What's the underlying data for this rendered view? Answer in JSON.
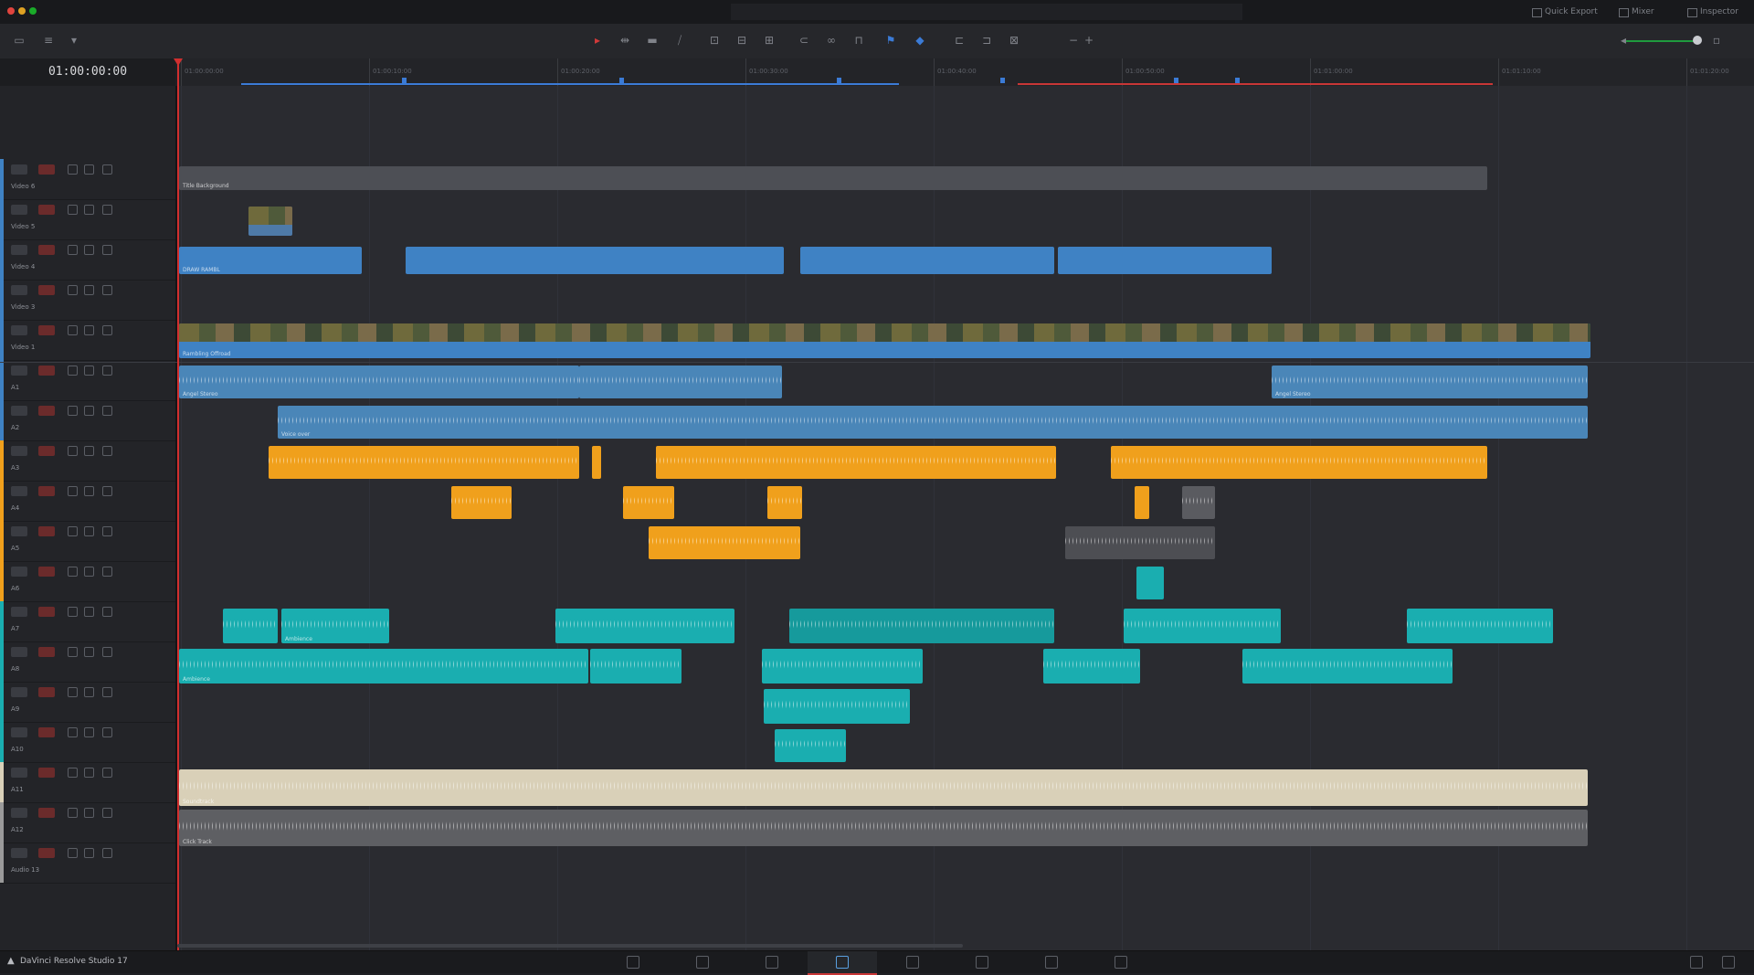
{
  "titlebar": {
    "buttons": [
      "Quick Export",
      "Mixer",
      "Inspector"
    ]
  },
  "timecode": "01:00:00:00",
  "ruler": {
    "labels": [
      "01:00:00:00",
      "01:00:10:00",
      "01:00:20:00",
      "01:00:30:00",
      "01:00:40:00",
      "01:00:50:00",
      "01:01:00:00",
      "01:01:10:00",
      "01:01:20:00"
    ]
  },
  "tracks": [
    {
      "name": "Video 6",
      "type": "video",
      "color": "#3f82c4"
    },
    {
      "name": "Video 5",
      "type": "video",
      "color": "#3f82c4"
    },
    {
      "name": "Video 4",
      "type": "video",
      "color": "#3f82c4"
    },
    {
      "name": "Video 3",
      "type": "video",
      "color": "#3f82c4"
    },
    {
      "name": "Video 1",
      "type": "video",
      "color": "#3f82c4"
    },
    {
      "name": "A1",
      "type": "audio",
      "color": "#3f82c4"
    },
    {
      "name": "A2",
      "type": "audio",
      "color": "#3f82c4"
    },
    {
      "name": "A3",
      "type": "audio",
      "color": "#f0a01c"
    },
    {
      "name": "A4",
      "type": "audio",
      "color": "#f0a01c"
    },
    {
      "name": "A5",
      "type": "audio",
      "color": "#f0a01c"
    },
    {
      "name": "A6",
      "type": "audio",
      "color": "#f0a01c"
    },
    {
      "name": "A7",
      "type": "audio",
      "color": "#1aaeb0"
    },
    {
      "name": "A8",
      "type": "audio",
      "color": "#1aaeb0"
    },
    {
      "name": "A9",
      "type": "audio",
      "color": "#1aaeb0"
    },
    {
      "name": "A10",
      "type": "audio",
      "color": "#1aaeb0"
    },
    {
      "name": "A11",
      "type": "audio",
      "color": "#d9d0b8"
    },
    {
      "name": "A12",
      "type": "audio",
      "color": "#9a9a9a"
    },
    {
      "name": "Audio 13",
      "type": "audio",
      "color": "#9a9a9a"
    }
  ],
  "clips": {
    "v6_clip": "Title Background",
    "v4_title": "DRAW RAMBL",
    "v1_main": "Rambling Offroad",
    "a_music": "Angel Stereo",
    "a_speech": "Voice over",
    "a_effects": "Ambience",
    "a_master": "Soundtrack",
    "a_click": "Click Track"
  },
  "bottombar": {
    "app_name": "DaVinci Resolve Studio 17"
  },
  "colors": {
    "playhead": "#d12f2f",
    "video": "#3f82c4",
    "orange": "#f0a01c",
    "teal": "#1aaeb0",
    "cream": "#d9d0b8"
  }
}
